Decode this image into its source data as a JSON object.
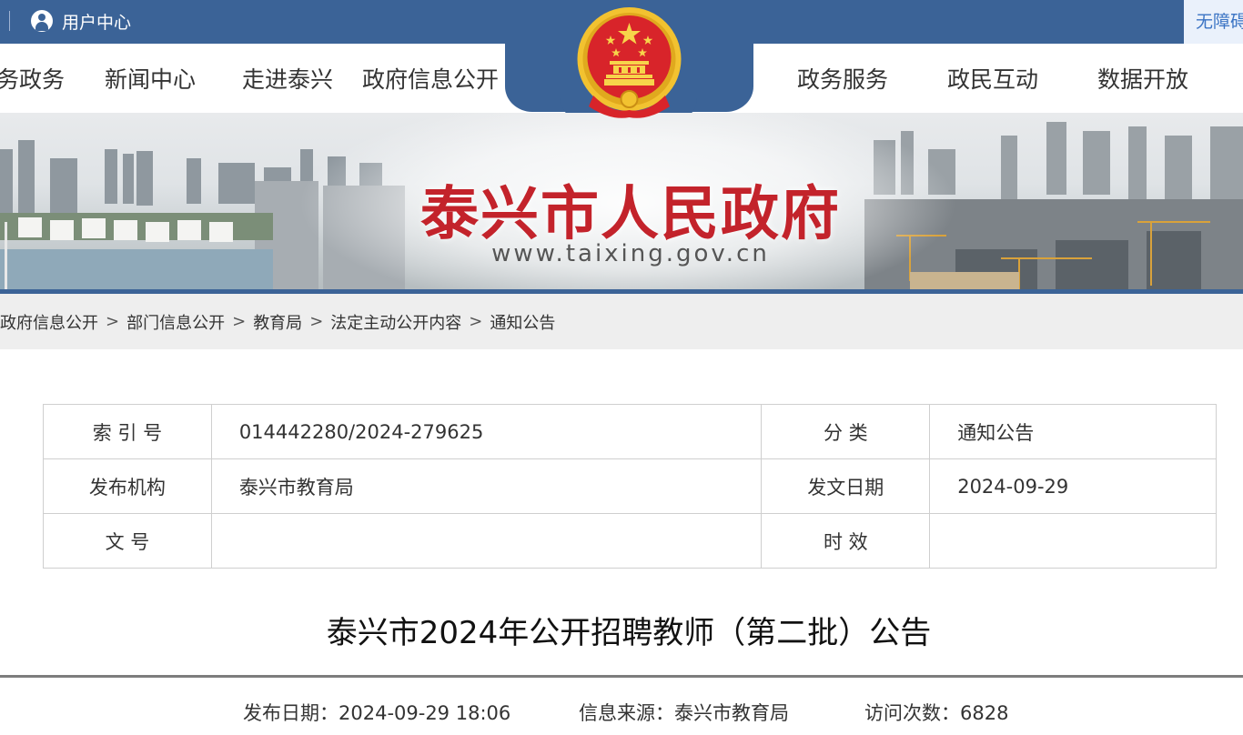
{
  "topbar": {
    "user_center": "用户中心",
    "accessibility": "无障碍"
  },
  "nav": {
    "items": [
      "务政务",
      "新闻中心",
      "走进泰兴",
      "政府信息公开",
      "政务服务",
      "政民互动",
      "数据开放"
    ]
  },
  "banner": {
    "title": "泰兴市人民政府",
    "url": "www.taixing.gov.cn"
  },
  "breadcrumb": [
    "政府信息公开",
    "部门信息公开",
    "教育局",
    "法定主动公开内容",
    "通知公告"
  ],
  "info": {
    "index_label": "索 引 号",
    "index_value": "014442280/2024-279625",
    "category_label": "分 类",
    "category_value": "通知公告",
    "publisher_label": "发布机构",
    "publisher_value": "泰兴市教育局",
    "issue_date_label": "发文日期",
    "issue_date_value": "2024-09-29",
    "doc_no_label": "文 号",
    "doc_no_value": "",
    "validity_label": "时 效",
    "validity_value": ""
  },
  "article": {
    "title": "泰兴市2024年公开招聘教师（第二批）公告",
    "publish_label": "发布日期：",
    "publish_value": "2024-09-29 18:06",
    "source_label": "信息来源：",
    "source_value": "泰兴市教育局",
    "visits_label": "访问次数：",
    "visits_value": "6828"
  },
  "colors": {
    "primary_blue": "#3b6397",
    "banner_red": "#c3232b",
    "emblem_red": "#d8242a",
    "emblem_gold": "#f2c230"
  },
  "icons": [
    "user-icon",
    "national-emblem-icon"
  ]
}
